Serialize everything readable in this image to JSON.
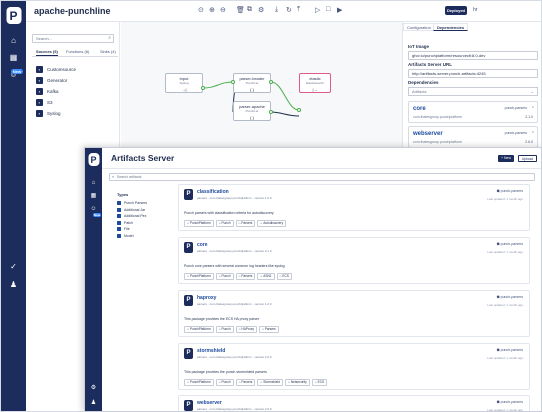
{
  "editor": {
    "project_title": "apache-punchline",
    "env_button": "Deployed",
    "user_initials": "hr",
    "rail": {
      "logo": "P",
      "new_badge": "New"
    },
    "left_panel": {
      "search_placeholder": "Search...",
      "tabs": [
        {
          "label": "Sources (5)",
          "active": true
        },
        {
          "label": "Functions (6)",
          "active": false
        },
        {
          "label": "Sinks (4)",
          "active": false
        }
      ],
      "sources": [
        "Customsource",
        "Generator",
        "Kafka",
        "S3",
        "Syslog"
      ]
    },
    "nodes": {
      "input": {
        "title": "Input",
        "subtitle": "Syslog",
        "icon": "→|"
      },
      "parser_header": {
        "title": "parser-header",
        "subtitle": "PunchLet",
        "icon": "{ }"
      },
      "parser_apache": {
        "title": "parser-apache",
        "subtitle": "PunchLet",
        "icon": "{ }"
      },
      "elastic": {
        "title": "elastic",
        "subtitle": "Elasticsearch",
        "icon": "|→"
      }
    },
    "right_panel": {
      "tabs": [
        {
          "label": "Configuration",
          "active": false
        },
        {
          "label": "Dependencies",
          "active": true
        }
      ],
      "iot_image_label": "IoT Image",
      "iot_image_value": "ghcr.io/punchplatform/resourcectl:8.0-dev",
      "artifacts_url_label": "Artifacts Server URL",
      "artifacts_url_value": "http://artifacts-server.punch-artifacts:4245",
      "dependencies_label": "Dependencies",
      "artifacts_select": "Artifacts",
      "deps": [
        {
          "name": "core",
          "tag": "punch-parsers",
          "path": "com.thalesgroup.punchplatform",
          "version": "2.1.0"
        },
        {
          "name": "webserver",
          "tag": "punch-parsers",
          "path": "com.thalesgroup.punchplatform",
          "version": "2.6.0"
        }
      ]
    }
  },
  "artifacts": {
    "title": "Artifacts Server",
    "new_button": "+ New",
    "upload_button": "Upload",
    "search_placeholder": "Search artifacts",
    "rail": {
      "logo": "P",
      "new_badge": "New"
    },
    "filters": {
      "title": "Types",
      "items": [
        "Punch Parsers",
        "Additional Jar",
        "Additional Pex",
        "Patch",
        "File",
        "Model"
      ]
    },
    "cards": [
      {
        "name": "classification",
        "meta": "parsers · com.thalesgroup.punchplatform · version 1.0.0",
        "tag": "punch-parsers",
        "updated": "Last updated: 1 month ago",
        "desc": "Punch parsers with classification criteria for autodiscovery",
        "chips": [
          "PunchPlatform",
          "Punch",
          "Parsers",
          "Autodiscovery"
        ]
      },
      {
        "name": "core",
        "meta": "parsers · com.thalesgroup.punchplatform · version 2.1.0",
        "tag": "punch-parsers",
        "updated": "Last updated: 1 month ago",
        "desc": "Punch core parsers with several common log headers like syslog",
        "chips": [
          "PunchPlatform",
          "Punch",
          "Parsers",
          "ASN1",
          "ECS"
        ]
      },
      {
        "name": "haproxy",
        "meta": "parsers · com.thalesgroup.punchplatform · version 1.2.3",
        "tag": "punch-parsers",
        "updated": "Last updated: 1 month ago",
        "desc": "This package provides the ECS HA proxy parser",
        "chips": [
          "PunchPlatform",
          "Punch",
          "HAProxy",
          "Parsers"
        ]
      },
      {
        "name": "stormshield",
        "meta": "parsers · com.thalesgroup.punchplatform · version 2.0.0",
        "tag": "punch-parsers",
        "updated": "Last updated: 1 month ago",
        "desc": "This package provides the punch stormshield parsers",
        "chips": [
          "PunchPlatform",
          "Punch",
          "Parsers",
          "Stormshield",
          "Netsecurity",
          "ECS"
        ]
      },
      {
        "name": "webserver",
        "meta": "parsers · com.thalesgroup.punchplatform · version 2.6.0",
        "tag": "punch-parsers",
        "updated": "Last updated: 1 month ago",
        "desc": "",
        "chips": []
      }
    ]
  }
}
